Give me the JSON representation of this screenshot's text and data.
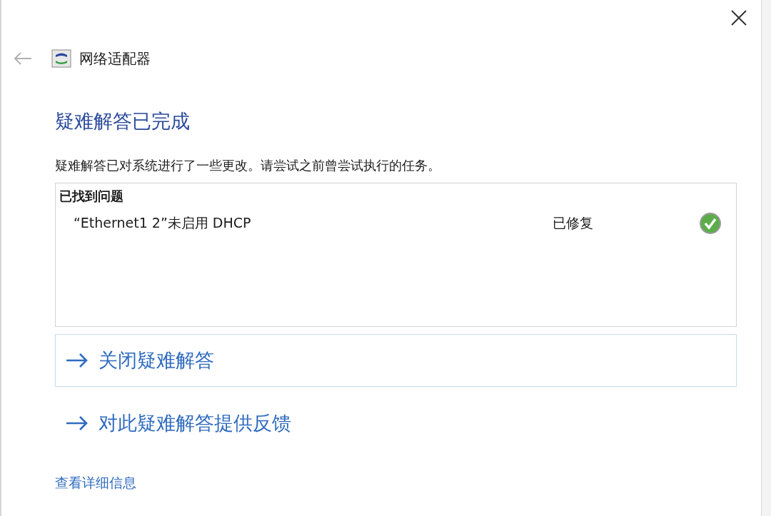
{
  "window": {
    "title": "网络适配器"
  },
  "heading": "疑难解答已完成",
  "description": "疑难解答已对系统进行了一些更改。请尝试之前曾尝试执行的任务。",
  "problems": {
    "header": "已找到问题",
    "items": [
      {
        "name": "“Ethernet1 2”未启用 DHCP",
        "status": "已修复",
        "fixed": true
      }
    ]
  },
  "commands": [
    {
      "label": "关闭疑难解答",
      "focused": true
    },
    {
      "label": "对此疑难解答提供反馈",
      "focused": false
    }
  ],
  "details_link": "查看详细信息"
}
